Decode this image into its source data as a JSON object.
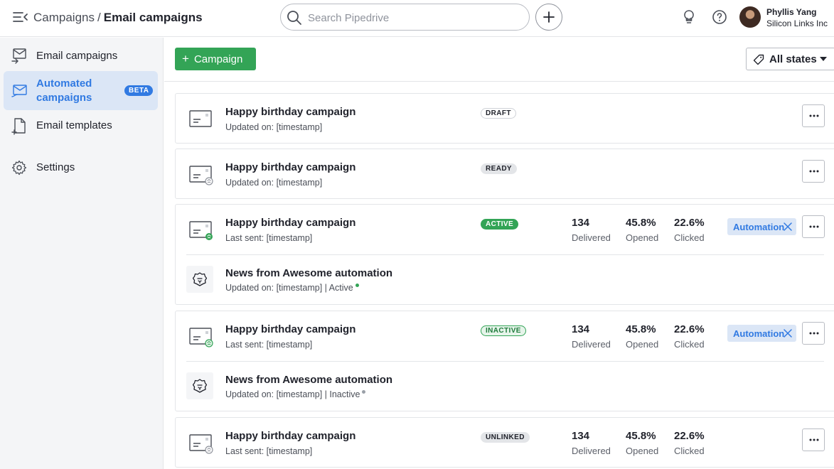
{
  "header": {
    "breadcrumb_parent": "Campaigns",
    "breadcrumb_separator": "/",
    "breadcrumb_current": "Email campaigns",
    "search_placeholder": "Search Pipedrive",
    "user_name": "Phyllis Yang",
    "user_company": "Silicon Links Inc"
  },
  "sidebar": {
    "items": [
      {
        "label": "Email campaigns",
        "icon": "email-campaign-icon"
      },
      {
        "label": "Automated campaigns",
        "icon": "automated-campaign-icon",
        "badge": "BETA",
        "active": true
      },
      {
        "label": "Email templates",
        "icon": "template-icon"
      },
      {
        "label": "Settings",
        "icon": "gear-icon"
      }
    ]
  },
  "toolbar": {
    "add_label": "Campaign",
    "state_filter": "All states"
  },
  "cards": [
    {
      "title": "Happy birthday campaign",
      "subtitle": "Updated on: [timestamp]",
      "status": "DRAFT"
    },
    {
      "title": "Happy birthday campaign",
      "subtitle": "Updated on: [timestamp]",
      "status": "READY"
    },
    {
      "title": "Happy birthday campaign",
      "subtitle": "Last sent: [timestamp]",
      "status": "ACTIVE",
      "stats": [
        {
          "value": "134",
          "label": "Delivered"
        },
        {
          "value": "45.8%",
          "label": "Opened"
        },
        {
          "value": "22.6%",
          "label": "Clicked"
        }
      ],
      "tag": "Automation",
      "automation": {
        "title": "News from Awesome automation",
        "subtitle": "Updated on: [timestamp] | Active",
        "dot_color": "#33a456"
      }
    },
    {
      "title": "Happy birthday campaign",
      "subtitle": "Last sent: [timestamp]",
      "status": "INACTIVE",
      "stats": [
        {
          "value": "134",
          "label": "Delivered"
        },
        {
          "value": "45.8%",
          "label": "Opened"
        },
        {
          "value": "22.6%",
          "label": "Clicked"
        }
      ],
      "tag": "Automation",
      "automation": {
        "title": "News from Awesome automation",
        "subtitle": "Updated on: [timestamp] | Inactive",
        "dot_color": "#9aa0a8"
      }
    },
    {
      "title": "Happy birthday campaign",
      "subtitle": "Last sent: [timestamp]",
      "status": "UNLINKED",
      "stats": [
        {
          "value": "134",
          "label": "Delivered"
        },
        {
          "value": "45.8%",
          "label": "Opened"
        },
        {
          "value": "22.6%",
          "label": "Clicked"
        }
      ]
    }
  ],
  "colors": {
    "accent_blue": "#317ae2",
    "primary_green": "#33a456",
    "sidebar_bg": "#f4f5f7",
    "active_nav_bg": "#dbe6f6"
  }
}
